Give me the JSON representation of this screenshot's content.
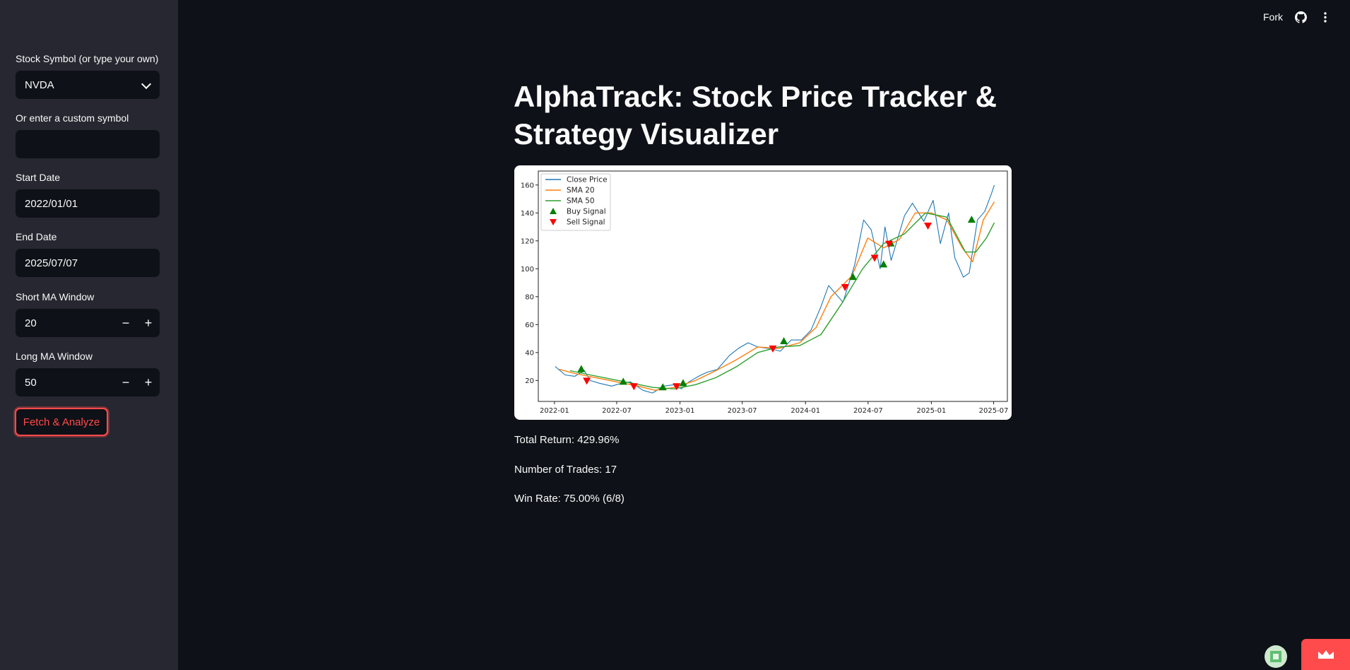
{
  "sidebar": {
    "symbol_label": "Stock Symbol (or type your own)",
    "symbol_value": "NVDA",
    "custom_label": "Or enter a custom symbol",
    "custom_value": "",
    "start_label": "Start Date",
    "start_value": "2022/01/01",
    "end_label": "End Date",
    "end_value": "2025/07/07",
    "short_label": "Short MA Window",
    "short_value": "20",
    "long_label": "Long MA Window",
    "long_value": "50",
    "minus": "−",
    "plus": "+",
    "fetch_label": "Fetch & Analyze"
  },
  "topbar": {
    "fork_label": "Fork"
  },
  "main": {
    "title": "AlphaTrack: Stock Price Tracker & Strategy Visualizer",
    "total_return": "Total Return: 429.96%",
    "num_trades": "Number of Trades: 17",
    "win_rate": "Win Rate: 75.00% (6/8)"
  },
  "colors": {
    "accent": "#ff4b4b",
    "close": "#1f77b4",
    "sma20": "#ff7f0e",
    "sma50": "#2ca02c",
    "buy": "#008000",
    "sell": "#ff0000"
  },
  "chart_data": {
    "type": "line",
    "xlabel": "",
    "ylabel": "",
    "xlim": [
      "2021-11-15",
      "2025-08-10"
    ],
    "ylim": [
      5,
      170
    ],
    "xticks": [
      "2022-01",
      "2022-07",
      "2023-01",
      "2023-07",
      "2024-01",
      "2024-07",
      "2025-01",
      "2025-07"
    ],
    "yticks": [
      20,
      40,
      60,
      80,
      100,
      120,
      140,
      160
    ],
    "legend": [
      "Close Price",
      "SMA 20",
      "SMA 50",
      "Buy Signal",
      "Sell Signal"
    ],
    "legend_position": "upper-left",
    "series": [
      {
        "name": "Close Price",
        "x": [
          "2022-01-03",
          "2022-02-01",
          "2022-03-01",
          "2022-03-29",
          "2022-04-15",
          "2022-05-12",
          "2022-06-16",
          "2022-07-15",
          "2022-08-10",
          "2022-09-15",
          "2022-10-13",
          "2022-11-15",
          "2022-12-15",
          "2023-01-05",
          "2023-01-27",
          "2023-02-24",
          "2023-03-22",
          "2023-04-20",
          "2023-05-25",
          "2023-06-20",
          "2023-07-18",
          "2023-08-15",
          "2023-09-15",
          "2023-10-20",
          "2023-11-20",
          "2023-12-20",
          "2024-01-17",
          "2024-02-15",
          "2024-03-08",
          "2024-04-19",
          "2024-05-23",
          "2024-06-18",
          "2024-07-10",
          "2024-08-05",
          "2024-08-19",
          "2024-09-06",
          "2024-10-15",
          "2024-11-07",
          "2024-12-10",
          "2025-01-06",
          "2025-01-27",
          "2025-02-20",
          "2025-03-10",
          "2025-04-04",
          "2025-04-21",
          "2025-05-15",
          "2025-06-05",
          "2025-06-25",
          "2025-07-03"
        ],
        "values": [
          30,
          24,
          23,
          27,
          20,
          18,
          16,
          18,
          19,
          13,
          11,
          16,
          17,
          14,
          19,
          23,
          26,
          28,
          38,
          43,
          47,
          44,
          43,
          41,
          49,
          49,
          56,
          73,
          88,
          76,
          103,
          135,
          128,
          100,
          130,
          106,
          138,
          147,
          134,
          149,
          118,
          140,
          108,
          94,
          97,
          135,
          141,
          154,
          160
        ]
      },
      {
        "name": "SMA 20",
        "x": [
          "2022-01-15",
          "2022-03-01",
          "2022-05-01",
          "2022-07-01",
          "2022-09-01",
          "2022-10-20",
          "2022-12-15",
          "2023-02-15",
          "2023-04-15",
          "2023-06-15",
          "2023-08-15",
          "2023-10-15",
          "2023-12-15",
          "2024-02-01",
          "2024-03-15",
          "2024-05-15",
          "2024-06-30",
          "2024-08-15",
          "2024-09-30",
          "2024-11-15",
          "2025-01-01",
          "2025-02-15",
          "2025-04-01",
          "2025-05-01",
          "2025-06-01",
          "2025-07-03"
        ],
        "values": [
          28,
          25,
          22,
          19,
          16,
          13,
          15,
          20,
          27,
          35,
          44,
          43,
          47,
          58,
          80,
          95,
          122,
          115,
          121,
          140,
          140,
          135,
          115,
          105,
          135,
          148
        ]
      },
      {
        "name": "SMA 50",
        "x": [
          "2022-02-15",
          "2022-04-15",
          "2022-06-15",
          "2022-08-15",
          "2022-10-15",
          "2022-12-15",
          "2023-02-15",
          "2023-04-15",
          "2023-06-15",
          "2023-08-15",
          "2023-10-15",
          "2023-12-15",
          "2024-02-15",
          "2024-04-15",
          "2024-06-15",
          "2024-08-15",
          "2024-10-15",
          "2024-12-15",
          "2025-02-15",
          "2025-04-10",
          "2025-05-10",
          "2025-06-10",
          "2025-07-03"
        ],
        "values": [
          27,
          24,
          21,
          18,
          15,
          14,
          17,
          22,
          30,
          40,
          44,
          45,
          53,
          75,
          100,
          118,
          125,
          140,
          137,
          112,
          112,
          122,
          133
        ]
      }
    ],
    "buy_signals": [
      {
        "x": "2022-03-20",
        "y": 28
      },
      {
        "x": "2022-07-20",
        "y": 19
      },
      {
        "x": "2022-11-12",
        "y": 15
      },
      {
        "x": "2023-01-10",
        "y": 18
      },
      {
        "x": "2023-10-30",
        "y": 48
      },
      {
        "x": "2024-05-18",
        "y": 94
      },
      {
        "x": "2024-08-15",
        "y": 103
      },
      {
        "x": "2024-09-05",
        "y": 118
      },
      {
        "x": "2025-04-28",
        "y": 135
      }
    ],
    "sell_signals": [
      {
        "x": "2022-04-05",
        "y": 20
      },
      {
        "x": "2022-08-20",
        "y": 16
      },
      {
        "x": "2022-12-22",
        "y": 16
      },
      {
        "x": "2023-09-28",
        "y": 43
      },
      {
        "x": "2024-04-25",
        "y": 87
      },
      {
        "x": "2024-07-20",
        "y": 108
      },
      {
        "x": "2024-08-31",
        "y": 118
      },
      {
        "x": "2024-12-22",
        "y": 131
      }
    ]
  }
}
